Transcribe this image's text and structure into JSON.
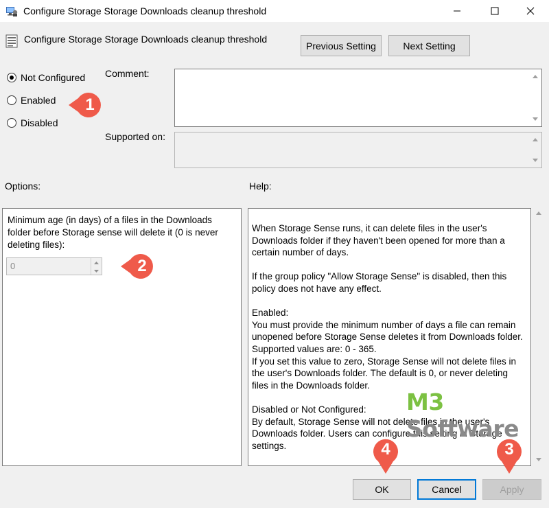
{
  "window": {
    "title": "Configure Storage Storage Downloads cleanup threshold",
    "icons": {
      "app": "group-policy-icon",
      "minimize": "minimize-icon",
      "maximize": "maximize-icon",
      "close": "close-icon"
    }
  },
  "policy": {
    "title": "Configure Storage Storage Downloads cleanup threshold",
    "icon": "policy-setting-icon"
  },
  "nav": {
    "previous_label": "Previous Setting",
    "next_label": "Next Setting"
  },
  "state": {
    "options": [
      {
        "label": "Not Configured",
        "checked": true
      },
      {
        "label": "Enabled",
        "checked": false
      },
      {
        "label": "Disabled",
        "checked": false
      }
    ]
  },
  "comment": {
    "label": "Comment:",
    "value": ""
  },
  "supported": {
    "label": "Supported on:",
    "value": ""
  },
  "options_section": {
    "label": "Options:",
    "description": "Minimum age (in days) of a files in the Downloads folder before Storage sense will delete it (0 is never deleting files):",
    "spinner_value": "0"
  },
  "help_section": {
    "label": "Help:",
    "paragraphs": [
      "When Storage Sense runs, it can delete files in the user's Downloads folder if they haven't been opened for more than a certain number of days.",
      "If the group policy \"Allow Storage Sense\" is disabled, then this policy does not have any effect.",
      "Enabled:\nYou must provide the minimum number of days a file can remain unopened before Storage Sense deletes it from Downloads folder. Supported values are: 0 - 365.\nIf you set this value to zero, Storage Sense will not delete files in the user's Downloads folder. The default is 0, or never deleting files in the Downloads folder.",
      "Disabled or Not Configured:\nBy default, Storage Sense will not delete files in the user's Downloads folder. Users can configure this setting in Storage settings."
    ]
  },
  "footer": {
    "ok_label": "OK",
    "cancel_label": "Cancel",
    "apply_label": "Apply"
  },
  "callouts": [
    "1",
    "2",
    "3",
    "4"
  ],
  "colors": {
    "callout": "#ef5a4a",
    "accent": "#0078d7",
    "watermark_green": "#7cc142",
    "watermark_gray": "#8a8a8a"
  },
  "watermark": {
    "part1": "M3",
    "part2": " Software"
  }
}
